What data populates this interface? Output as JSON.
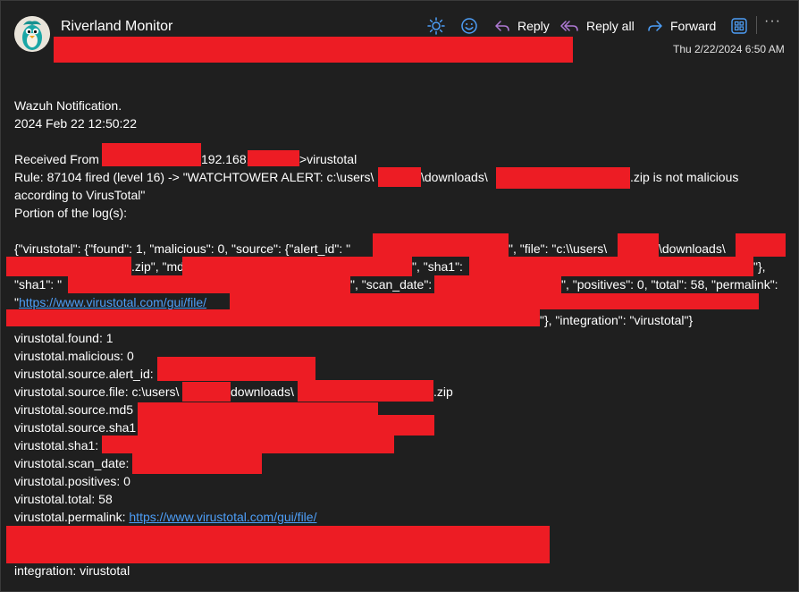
{
  "header": {
    "sender": "Riverland Monitor",
    "date": "Thu 2/22/2024 6:50 AM"
  },
  "toolbar": {
    "reply": "Reply",
    "reply_all": "Reply all",
    "forward": "Forward",
    "more": "···"
  },
  "colors": {
    "accent": "#4d9ef7",
    "redaction": "#ed1c24",
    "reply_all_icon": "#b07ad6",
    "background": "#1f1f1f"
  },
  "icons": [
    "sun-icon",
    "emoji-icon",
    "reply-icon",
    "reply-all-icon",
    "forward-icon",
    "apps-icon",
    "more-icon"
  ],
  "body": {
    "l1": "Wazuh Notification.",
    "l2": "2024 Feb 22 12:50:22",
    "l3a": "Received From",
    "l3b": "192.168.",
    "l3c": ">virustotal",
    "l4a": "Rule: 87104 fired (level 16) -> \"WATCHTOWER ALERT: c:\\users\\",
    "l4b": "\\downloads\\",
    "l4c": ".zip is not malicious",
    "l5": "according to VirusTotal\"",
    "l6": "Portion of the log(s):",
    "j1a": "{\"virustotal\": {\"found\": 1, \"malicious\": 0, \"source\": {\"alert_id\": \"",
    "j1b": "\", \"file\": \"c:\\\\users\\",
    "j1c": "\\downloads\\",
    "j2a": ".zip\", \"md5\": ",
    "j2b": "\", \"sha1\": ",
    "j2c": "\"},",
    "j3a": "\"sha1\": \"",
    "j3b": "\", \"scan_date\": \"",
    "j3c": "\", \"positives\": 0, \"total\": 58, \"permalink\":",
    "j4a": "\"",
    "j4link": "https://www.virustotal.com/gui/file/",
    "j5": "\"}, \"integration\": \"virustotal\"}",
    "f1": "virustotal.found: 1",
    "f2": "virustotal.malicious: 0",
    "f3": "virustotal.source.alert_id:",
    "f4a": "virustotal.source.file: c:\\users\\",
    "f4b": "downloads\\",
    "f4c": ".zip",
    "f5": "virustotal.source.md5",
    "f6": "virustotal.source.sha1",
    "f7": "virustotal.sha1:",
    "f8": "virustotal.scan_date:",
    "f9": "virustotal.positives: 0",
    "f10": "virustotal.total: 58",
    "f11": "virustotal.permalink: ",
    "f11link": "https://www.virustotal.com/gui/file/",
    "f12": "integration: virustotal"
  }
}
